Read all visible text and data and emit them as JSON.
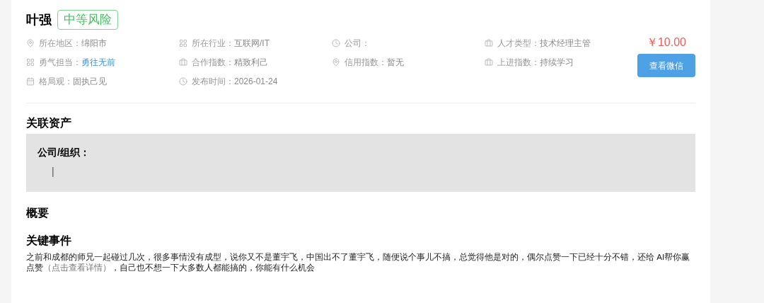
{
  "profile": {
    "name": "叶强",
    "risk_badge": "中等风险",
    "price": "￥10.00",
    "button": "查看微信",
    "fields": [
      {
        "kind": "pin",
        "label": "所在地区：",
        "value": "绵阳市",
        "highlighted": false
      },
      {
        "kind": "grid",
        "label": "所在行业：",
        "value": "互联网/IT",
        "highlighted": false
      },
      {
        "kind": "clock",
        "label": "公司："
      },
      {
        "kind": "briefcase",
        "label": "人才类型：",
        "value": "技术经理主管",
        "highlighted": false
      },
      {
        "kind": "grid",
        "label": "勇气担当：",
        "value": "勇往无前",
        "highlighted": true
      },
      {
        "kind": "briefcase",
        "label": "合作指数：",
        "value": "精致利己",
        "highlighted": false
      },
      {
        "kind": "pin",
        "label": "信用指数：",
        "value": "暂无",
        "highlighted": false
      },
      {
        "kind": "briefcase",
        "label": "上进指数：",
        "value": "持续学习",
        "highlighted": false
      },
      {
        "kind": "calendar",
        "label": "格局观：",
        "value": "固执己见",
        "highlighted": false
      },
      {
        "kind": "clock",
        "label": "发布时间：",
        "value": "2026-01-24",
        "highlighted": false
      }
    ]
  },
  "assets": {
    "title": "关联资产",
    "label": "公司/组织：",
    "value": "|"
  },
  "summary": {
    "title": "概要"
  },
  "key_events": {
    "title": "关键事件",
    "before": "之前和成都的师兄一起碰过几次，很多事情没有成型，说你又不是董宇飞，中国出不了董宇飞，随便说个事儿不搞，总觉得他是对的，偶尔点赞一下已经十分不错，还给 AI帮你赢点赞",
    "link": "（点击查看详情）",
    "after": "，自己也不想一下大多数人都能搞的，你能有什么机会"
  }
}
